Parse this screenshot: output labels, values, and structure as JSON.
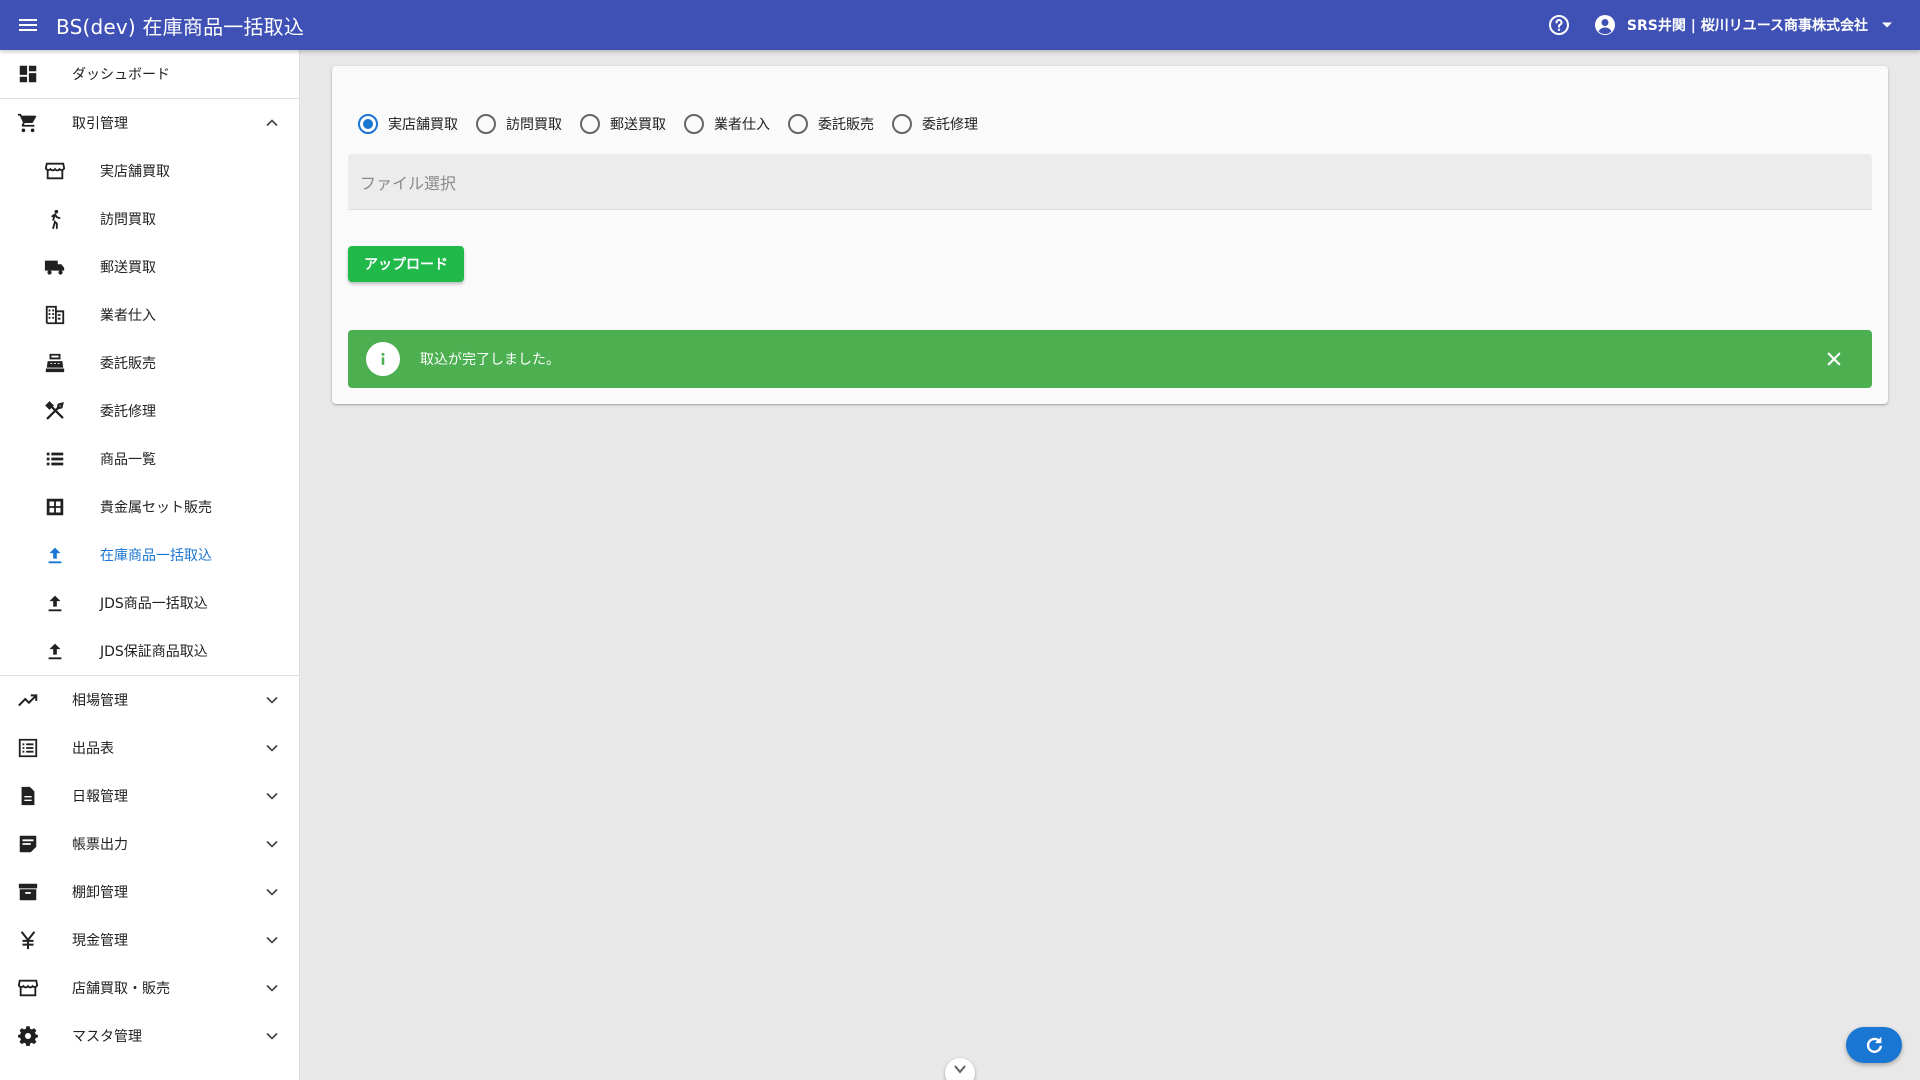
{
  "appbar": {
    "title": "BS(dev) 在庫商品一括取込",
    "user_name": "SRS井関 | 桜川リユース商事株式会社"
  },
  "sidebar": {
    "items": [
      {
        "label": "ダッシュボード",
        "icon": "dashboard-icon"
      },
      {
        "label": "取引管理",
        "icon": "cart-icon",
        "expanded": true
      },
      {
        "label": "相場管理",
        "icon": "trending-up-icon"
      },
      {
        "label": "出品表",
        "icon": "list-alt-icon"
      },
      {
        "label": "日報管理",
        "icon": "document-icon"
      },
      {
        "label": "帳票出力",
        "icon": "sticky-note-icon"
      },
      {
        "label": "棚卸管理",
        "icon": "archive-icon"
      },
      {
        "label": "現金管理",
        "icon": "yen-icon"
      },
      {
        "label": "店舗買取・販売",
        "icon": "store-icon"
      },
      {
        "label": "マスタ管理",
        "icon": "gear-icon"
      }
    ],
    "sub_items": [
      {
        "label": "実店舗買取",
        "icon": "store-icon"
      },
      {
        "label": "訪問買取",
        "icon": "walk-icon"
      },
      {
        "label": "郵送買取",
        "icon": "truck-icon"
      },
      {
        "label": "業者仕入",
        "icon": "building-icon"
      },
      {
        "label": "委託販売",
        "icon": "cash-register-icon"
      },
      {
        "label": "委託修理",
        "icon": "tools-icon"
      },
      {
        "label": "商品一覧",
        "icon": "list-icon"
      },
      {
        "label": "貴金属セット販売",
        "icon": "grid-icon"
      },
      {
        "label": "在庫商品一括取込",
        "icon": "upload-icon",
        "active": true
      },
      {
        "label": "JDS商品一括取込",
        "icon": "upload-icon"
      },
      {
        "label": "JDS保証商品取込",
        "icon": "upload-icon"
      }
    ]
  },
  "main": {
    "radio_options": [
      "実店舗買取",
      "訪問買取",
      "郵送買取",
      "業者仕入",
      "委託販売",
      "委託修理"
    ],
    "selected_option": "実店舗買取",
    "file_placeholder": "ファイル選択",
    "upload_label": "アップロード",
    "alert_message": "取込が完了しました。"
  },
  "colors": {
    "appbar": "#3f51b5",
    "primary": "#1976d2",
    "upload_button": "#21b94a",
    "alert_success": "#4caf50"
  }
}
